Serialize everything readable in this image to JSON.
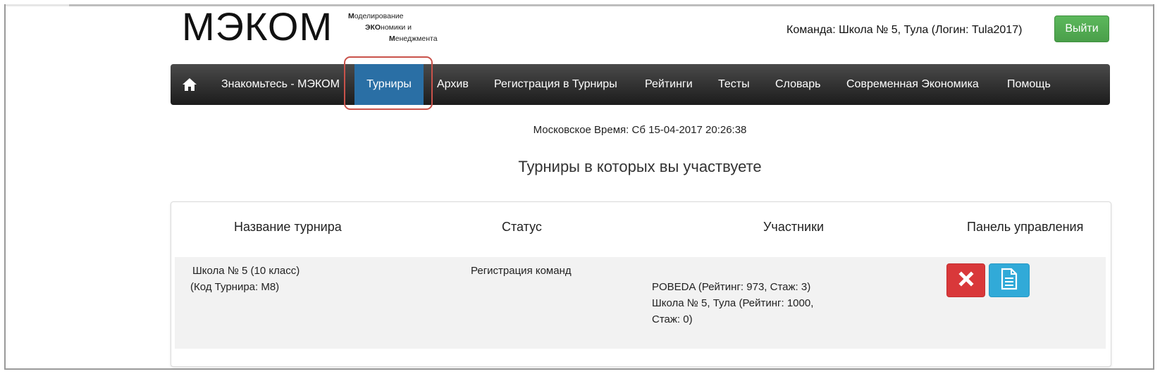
{
  "logo": {
    "big": "МЭКОМ",
    "line1": {
      "bold": "М",
      "rest": "оделирование"
    },
    "line2": {
      "bold": "ЭКО",
      "rest": "номики и"
    },
    "line3": {
      "bold": "М",
      "rest": "енеджмента"
    }
  },
  "header": {
    "team_info": "Команда: Школа № 5, Тула (Логин: Tula2017)",
    "logout_label": "Выйти"
  },
  "nav": {
    "items": [
      {
        "label": "Знакомьтесь - МЭКОМ"
      },
      {
        "label": "Турниры",
        "active": true
      },
      {
        "label": "Архив"
      },
      {
        "label": "Регистрация в Турниры"
      },
      {
        "label": "Рейтинги"
      },
      {
        "label": "Тесты"
      },
      {
        "label": "Словарь"
      },
      {
        "label": "Современная Экономика"
      },
      {
        "label": "Помощь"
      }
    ]
  },
  "moscow_time": "Московское Время: Сб 15-04-2017 20:26:38",
  "page_title": "Турниры в которых вы участвуете",
  "table": {
    "headers": [
      "Название турнира",
      "Статус",
      "Участники",
      "Панель управления"
    ],
    "rows": [
      {
        "name_line1": "Школа № 5 (10 класс)",
        "name_line2": "(Код Турнира: М8)",
        "status": "Регистрация команд",
        "participants": [
          "POBEDA (Рейтинг: 973, Стаж: 3)",
          "Школа № 5, Тула (Рейтинг: 1000,",
          "Стаж: 0)"
        ]
      }
    ]
  },
  "colors": {
    "nav_active": "#2a6fa5",
    "logout": "#5cb85c",
    "delete": "#d9383a",
    "doc": "#31aad8",
    "highlight": "#c9524a"
  }
}
